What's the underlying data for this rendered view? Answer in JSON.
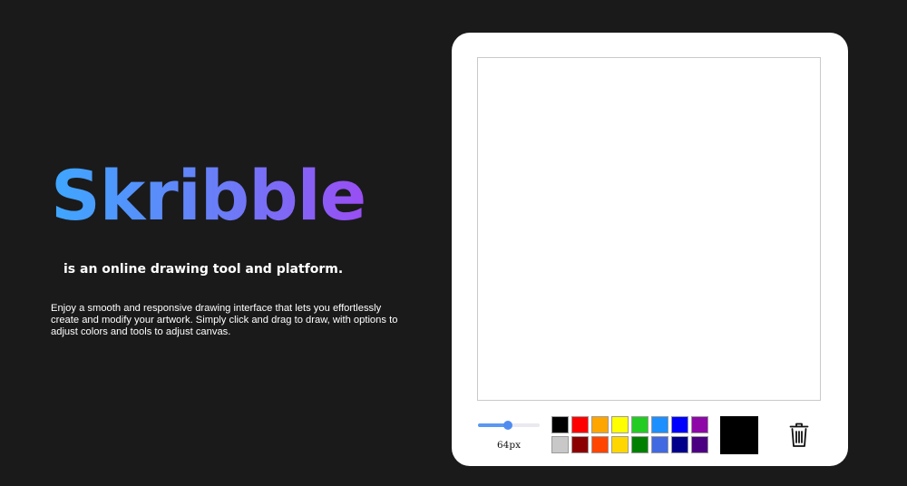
{
  "hero": {
    "title": "Skribble",
    "tagline": "is an online drawing tool and platform.",
    "description": "Enjoy a smooth and responsive drawing interface that lets you effortlessly create and modify your artwork. Simply click and drag to draw, with options to adjust colors and tools to adjust canvas."
  },
  "toolbar": {
    "brush_size_label": "64px",
    "brush_size_fraction": 0.48,
    "current_color": "#000000",
    "clear_icon": "trash-icon",
    "palette": [
      [
        "#000000",
        "#ff0000",
        "#ffa500",
        "#ffff00",
        "#22cc22",
        "#1e8fff",
        "#0000ff",
        "#8e08a8"
      ],
      [
        "#c8c8c8",
        "#8b0000",
        "#ff4500",
        "#ffd700",
        "#008000",
        "#4169e1",
        "#00008b",
        "#4b0082"
      ]
    ]
  },
  "colors": {
    "background": "#1a1a1b",
    "panel": "#ffffff",
    "title_gradient_start": "#3ea7ff",
    "title_gradient_end": "#9a4df4",
    "slider_accent": "#5a98f2"
  }
}
